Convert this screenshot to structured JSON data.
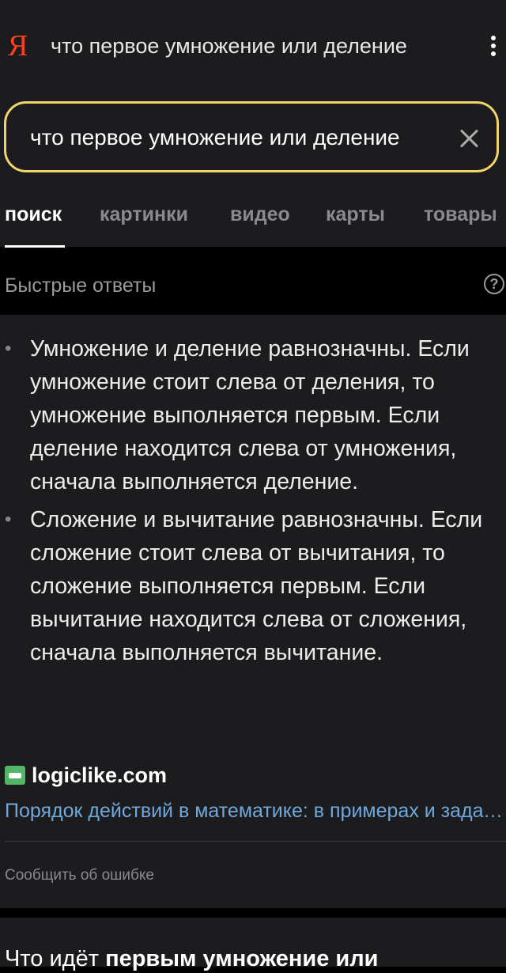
{
  "topbar": {
    "logo": "Я",
    "title": "что первое умножение или деление"
  },
  "search": {
    "value": "что первое умножение или деление"
  },
  "tabs": [
    "поиск",
    "картинки",
    "видео",
    "карты",
    "товары"
  ],
  "quick_answers": {
    "title": "Быстрые ответы",
    "help": "?",
    "bullets": [
      "Умножение и деление равнозначны. Если умножение стоит слева от деления, то умножение выполняется первым. Если деление находится слева от умножения, сначала выполняется деление.",
      "Сложение и вычитание равнозначны. Если сложение стоит слева от вычитания, то сложение выполняется первым. Если вычитание находится слева от сложения, сначала выполняется вычитание."
    ],
    "source_name": "logiclike.com",
    "source_link": "Порядок действий в математике: в примерах и задачах",
    "report": "Сообщить об ошибке"
  },
  "next_result": {
    "title_plain": "Что идёт ",
    "title_bold": "первым умножение или"
  },
  "colors": {
    "accent": "#f2d36b",
    "logo": "#fc3f1d",
    "link": "#6fa8dc"
  }
}
